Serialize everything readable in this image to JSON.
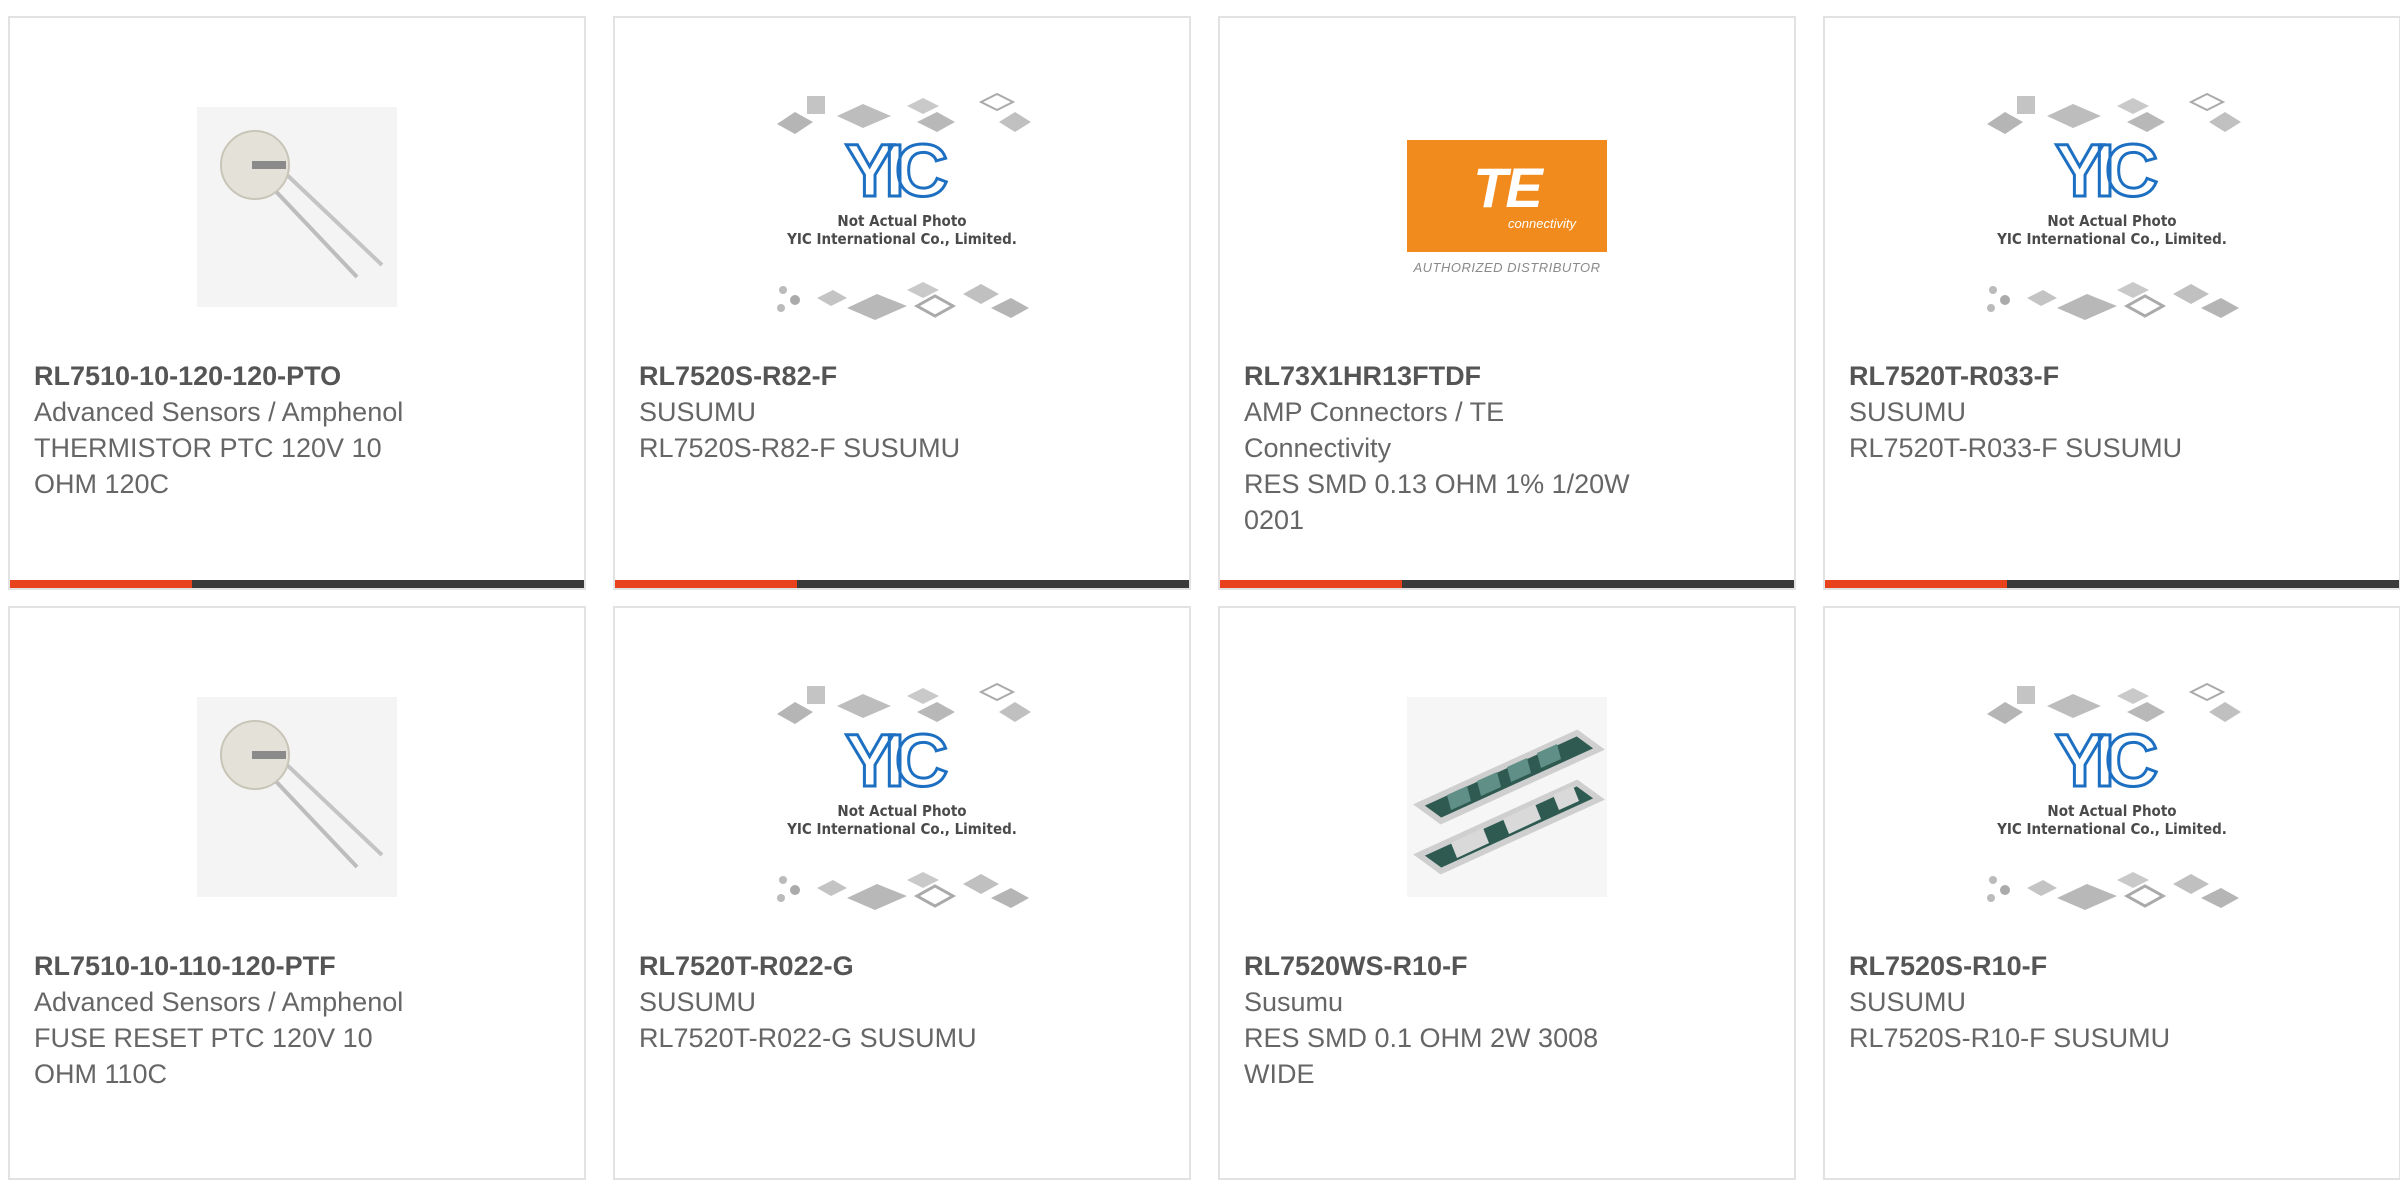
{
  "products": [
    {
      "part_number": "RL7510-10-120-120-PTO",
      "lines": [
        "Advanced Sensors / Amphenol",
        "THERMISTOR PTC 120V 10",
        "OHM 120C"
      ],
      "image": "thermistor-photo"
    },
    {
      "part_number": "RL7520S-R82-F",
      "lines": [
        "SUSUMU",
        "RL7520S-R82-F SUSUMU"
      ],
      "image": "yic-placeholder"
    },
    {
      "part_number": "RL73X1HR13FTDF",
      "lines": [
        "AMP Connectors / TE",
        "Connectivity",
        "RES SMD 0.13 OHM 1% 1/20W",
        "0201"
      ],
      "image": "te-logo"
    },
    {
      "part_number": "RL7520T-R033-F",
      "lines": [
        "SUSUMU",
        "RL7520T-R033-F SUSUMU"
      ],
      "image": "yic-placeholder"
    },
    {
      "part_number": "RL7510-10-110-120-PTF",
      "lines": [
        "Advanced Sensors / Amphenol",
        "FUSE RESET PTC 120V 10",
        "OHM 110C"
      ],
      "image": "thermistor-photo"
    },
    {
      "part_number": "RL7520T-R022-G",
      "lines": [
        "SUSUMU",
        "RL7520T-R022-G SUSUMU"
      ],
      "image": "yic-placeholder"
    },
    {
      "part_number": "RL7520WS-R10-F",
      "lines": [
        "Susumu",
        "RES SMD 0.1 OHM 2W 3008",
        "WIDE"
      ],
      "image": "resistor-photo"
    },
    {
      "part_number": "RL7520S-R10-F",
      "lines": [
        "SUSUMU",
        "RL7520S-R10-F SUSUMU"
      ],
      "image": "yic-placeholder"
    }
  ],
  "placeholder": {
    "logo": "YIC",
    "line1": "Not Actual Photo",
    "line2": "YIC International Co., Limited."
  },
  "te": {
    "mark": "TE",
    "sub": "connectivity",
    "authorized": "AUTHORIZED DISTRIBUTOR"
  },
  "colors": {
    "accent": "#e8421c",
    "bar": "#3a3a3a",
    "te_orange": "#f28b1e",
    "yic_blue": "#1d6fc2"
  }
}
